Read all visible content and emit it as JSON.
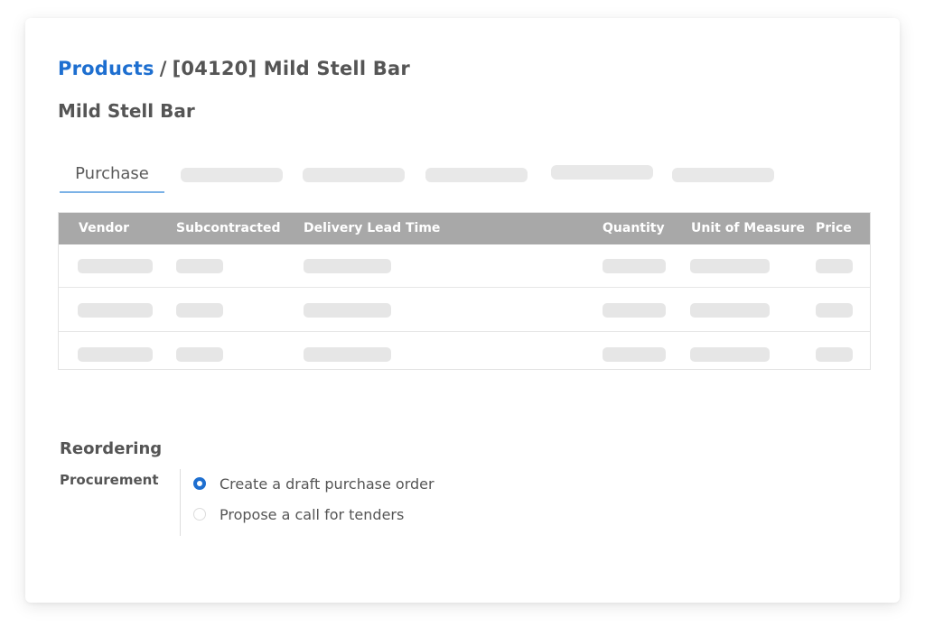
{
  "breadcrumb": {
    "parent": "Products",
    "separator": "/",
    "current": "[04120] Mild Stell Bar"
  },
  "page_title": "Mild Stell Bar",
  "tabs": [
    {
      "label": "Purchase",
      "active": true
    }
  ],
  "table": {
    "columns": [
      "Vendor",
      "Subcontracted",
      "Delivery Lead Time",
      "Quantity",
      "Unit of Measure",
      "Price"
    ]
  },
  "reordering": {
    "section_title": "Reordering",
    "field_label": "Procurement",
    "options": [
      {
        "label": "Create a draft purchase order",
        "selected": true
      },
      {
        "label": "Propose a call for tenders",
        "selected": false
      }
    ]
  },
  "colors": {
    "link": "#1e6fd0",
    "table_header": "#a8a8a8",
    "tab_underline": "#7bb2e6",
    "skeleton": "#e8e8e8"
  }
}
